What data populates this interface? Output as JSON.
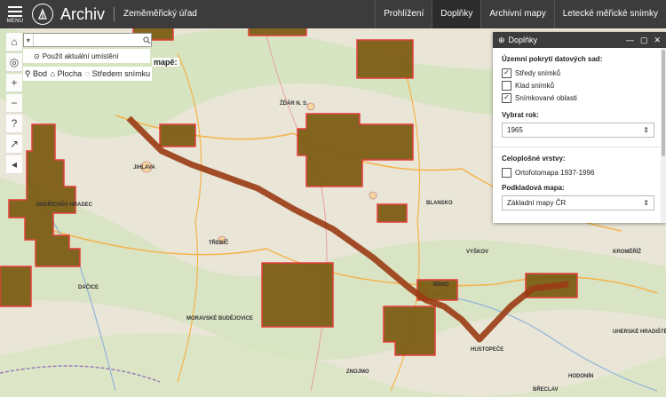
{
  "header": {
    "menu_label": "MENU",
    "app_title": "Archiv",
    "subtitle": "Zeměměřický úřad",
    "nav": [
      "Prohlížení",
      "Doplňky",
      "Archivní mapy",
      "Letecké měřické snímky"
    ]
  },
  "search": {
    "placeholder": "",
    "use_location": "Použít aktuální umístění"
  },
  "modes": {
    "point": "Bod",
    "area": "Plocha",
    "center": "Středem snímku"
  },
  "map_label": "mapě:",
  "map_places": [
    "JIHLAVA",
    "ŽĎÁR N. S.",
    "TŘEBÍČ",
    "BLANSKO",
    "BRNO",
    "VYŠKOV",
    "ZNOJMO",
    "HODONÍN",
    "KROMĚŘÍŽ",
    "JINDŘICHŮV HRADEC",
    "DAČICE",
    "UHERSKÉ HRADIŠTĚ",
    "BŘECLAV",
    "HUSTOPEČE",
    "MORAVSKÉ BUDĚJOVICE"
  ],
  "panel": {
    "title": "Doplňky",
    "coverage_title": "Územní pokrytí datových sad:",
    "coverage_items": [
      {
        "label": "Středy snímků",
        "checked": true
      },
      {
        "label": "Klad snímků",
        "checked": false
      },
      {
        "label": "Snímkované oblasti",
        "checked": true
      }
    ],
    "year_title": "Vybrat rok:",
    "year_value": "1965",
    "full_layers_title": "Celoplošné vrstvy:",
    "ortho_label": "Ortofotomapa 1937-1996",
    "base_title": "Podkladová mapa:",
    "base_value": "Základní mapy ČR"
  },
  "colors": {
    "header_bg": "#3c3c3c",
    "tile_fill": "#7a5a10",
    "tile_border": "#e53030",
    "route": "#9a3b14"
  }
}
